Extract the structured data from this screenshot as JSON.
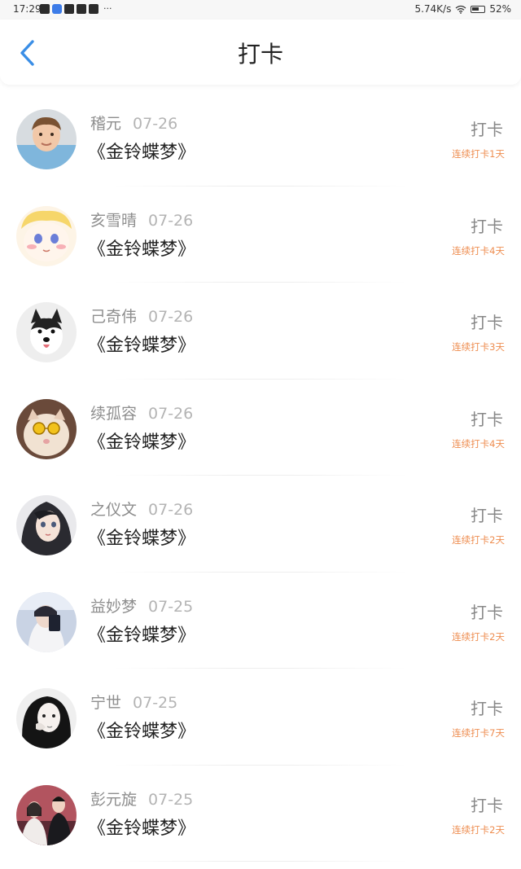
{
  "status_bar": {
    "time": "17:29",
    "more": "···",
    "network_speed": "5.74K/s",
    "battery": "52%"
  },
  "header": {
    "title": "打卡",
    "back_icon": "chevron-left-icon"
  },
  "colors": {
    "accent_blue": "#3a8ee6",
    "streak_orange": "#ee8d50",
    "name_gray": "#8e8e8e",
    "date_gray": "#b4b4b4"
  },
  "checkins": [
    {
      "name": "稽元",
      "date": "07-26",
      "book": "《金铃蝶梦》",
      "action": "打卡",
      "streak": "连续打卡1天"
    },
    {
      "name": "亥雪晴",
      "date": "07-26",
      "book": "《金铃蝶梦》",
      "action": "打卡",
      "streak": "连续打卡4天"
    },
    {
      "name": "己奇伟",
      "date": "07-26",
      "book": "《金铃蝶梦》",
      "action": "打卡",
      "streak": "连续打卡3天"
    },
    {
      "name": "续孤容",
      "date": "07-26",
      "book": "《金铃蝶梦》",
      "action": "打卡",
      "streak": "连续打卡4天"
    },
    {
      "name": "之仪文",
      "date": "07-26",
      "book": "《金铃蝶梦》",
      "action": "打卡",
      "streak": "连续打卡2天"
    },
    {
      "name": "益妙梦",
      "date": "07-25",
      "book": "《金铃蝶梦》",
      "action": "打卡",
      "streak": "连续打卡2天"
    },
    {
      "name": "宁世",
      "date": "07-25",
      "book": "《金铃蝶梦》",
      "action": "打卡",
      "streak": "连续打卡7天"
    },
    {
      "name": "彭元旋",
      "date": "07-25",
      "book": "《金铃蝶梦》",
      "action": "打卡",
      "streak": "连续打卡2天"
    }
  ]
}
